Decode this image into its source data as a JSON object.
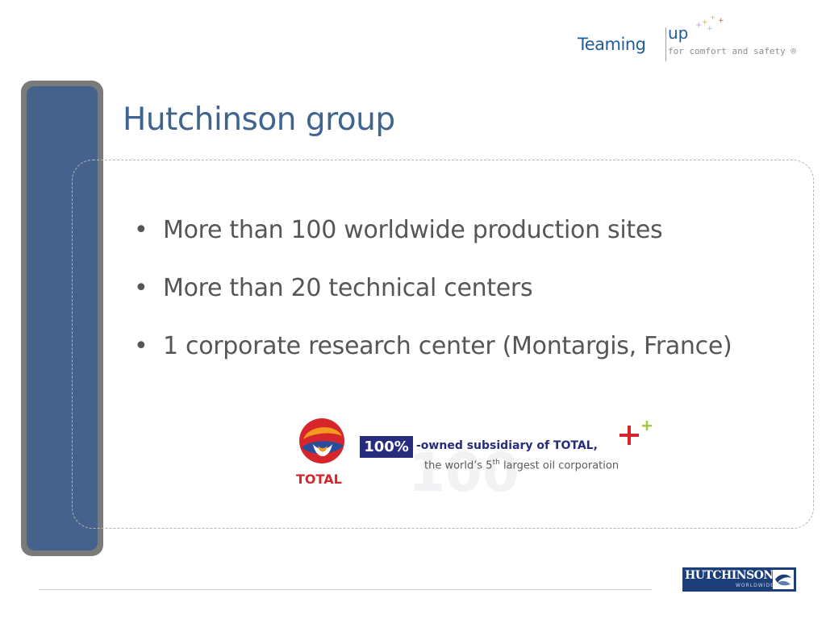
{
  "header": {
    "logo_word": "Teaming",
    "logo_up": "up",
    "logo_tagline": "for comfort and safety ®"
  },
  "slide": {
    "title": "Hutchinson group",
    "bullets": [
      "More than 100 worldwide production sites",
      "More than 20 technical centers",
      "1 corporate research center (Montargis, France)"
    ]
  },
  "total_banner": {
    "brand": "TOTAL",
    "percent": "100%",
    "owned_text": "-owned subsidiary of TOTAL,",
    "world_prefix": "the world’s 5",
    "world_sup": "th",
    "world_suffix": " largest oil corporation",
    "watermark": "100"
  },
  "footer": {
    "hutchinson_name": "HUTCHINSON",
    "hutchinson_sub": "WORLDWIDE"
  },
  "colors": {
    "title": "#3f6490",
    "side_bar": "#45628d",
    "total_red": "#d6262c",
    "total_blue": "#272d7c"
  }
}
